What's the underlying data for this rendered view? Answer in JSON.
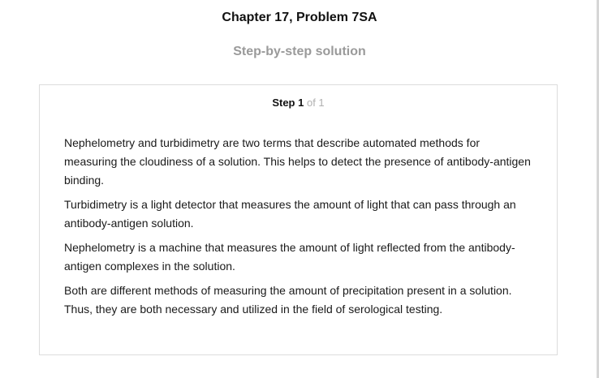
{
  "header": {
    "chapter_title": "Chapter 17, Problem 7SA",
    "subtitle": "Step-by-step solution"
  },
  "step": {
    "label": "Step 1",
    "of_text": "of 1"
  },
  "solution": {
    "paragraphs": [
      "Nephelometry and turbidimetry are two terms that describe automated methods for measuring the cloudiness of a solution. This helps to detect the presence of antibody-antigen binding.",
      "Turbidimetry is a light detector that measures the amount of light that can pass through an antibody-antigen solution.",
      "Nephelometry is a machine that measures the amount of light reflected from the antibody-antigen complexes in the solution.",
      "Both are different methods of measuring the amount of precipitation present in a solution. Thus, they are both necessary and utilized in the field of serological testing."
    ]
  }
}
